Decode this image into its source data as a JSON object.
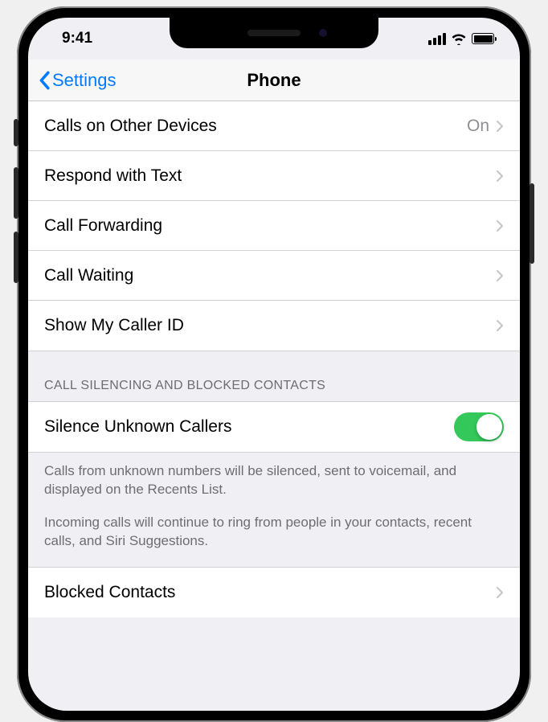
{
  "status": {
    "time": "9:41"
  },
  "nav": {
    "back": "Settings",
    "title": "Phone"
  },
  "rows": {
    "callsOtherDevices": {
      "label": "Calls on Other Devices",
      "value": "On"
    },
    "respondText": {
      "label": "Respond with Text"
    },
    "callForwarding": {
      "label": "Call Forwarding"
    },
    "callWaiting": {
      "label": "Call Waiting"
    },
    "showCallerId": {
      "label": "Show My Caller ID"
    },
    "silenceUnknown": {
      "label": "Silence Unknown Callers",
      "on": true
    },
    "blockedContacts": {
      "label": "Blocked Contacts"
    }
  },
  "sections": {
    "silencing": {
      "header": "CALL SILENCING AND BLOCKED CONTACTS",
      "footer1": "Calls from unknown numbers will be silenced, sent to voicemail, and displayed on the Recents List.",
      "footer2": "Incoming calls will continue to ring from people in your contacts, recent calls, and Siri Suggestions."
    }
  }
}
